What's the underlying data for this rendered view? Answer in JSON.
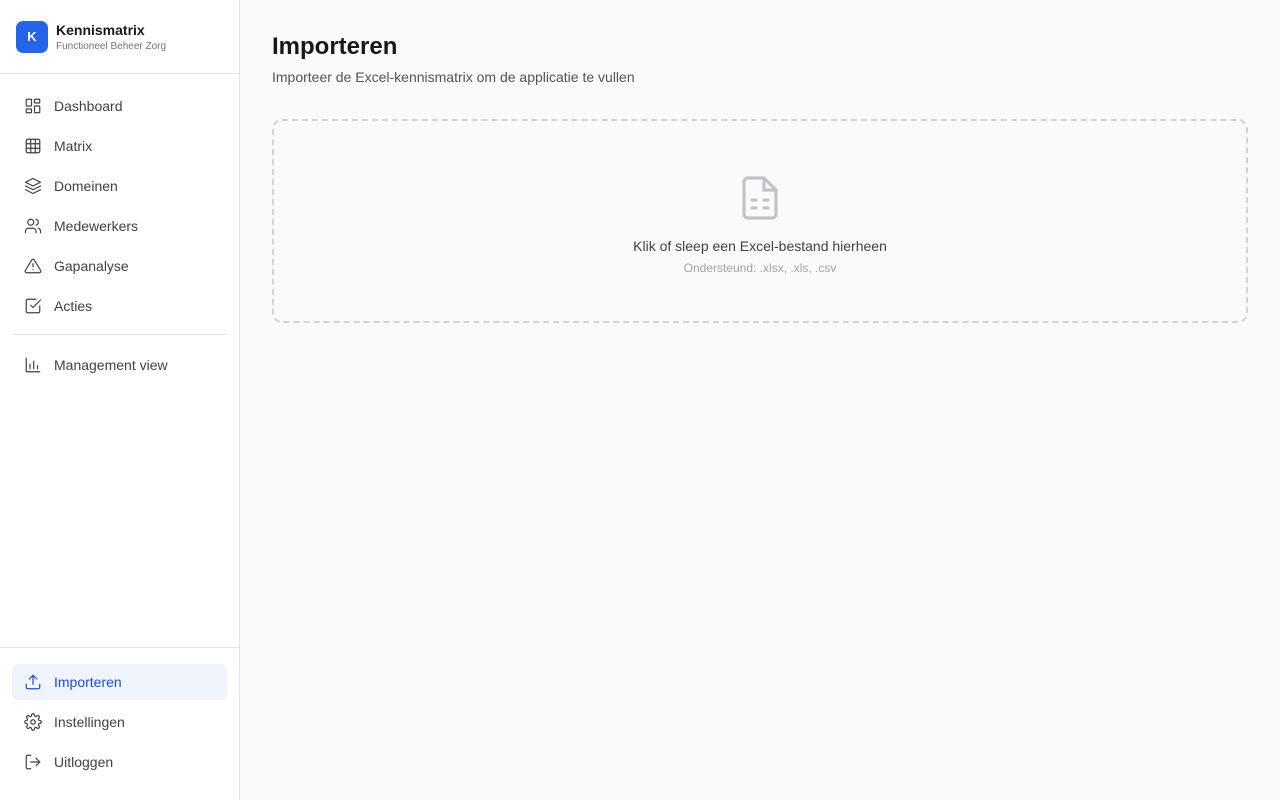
{
  "brand": {
    "logo_letter": "K",
    "name": "Kennismatrix",
    "subtitle": "Functioneel Beheer Zorg",
    "accent": "#2563eb"
  },
  "nav": {
    "main": [
      {
        "label": "Dashboard",
        "icon": "layout-dashboard-icon"
      },
      {
        "label": "Matrix",
        "icon": "grid-table-icon"
      },
      {
        "label": "Domeinen",
        "icon": "layers-icon"
      },
      {
        "label": "Medewerkers",
        "icon": "users-icon"
      },
      {
        "label": "Gapanalyse",
        "icon": "alert-triangle-icon"
      },
      {
        "label": "Acties",
        "icon": "check-square-icon"
      }
    ],
    "secondary": [
      {
        "label": "Management view",
        "icon": "bar-chart-icon"
      }
    ],
    "bottom": [
      {
        "label": "Importeren",
        "icon": "upload-icon",
        "active": true
      },
      {
        "label": "Instellingen",
        "icon": "gear-icon"
      },
      {
        "label": "Uitloggen",
        "icon": "logout-icon"
      }
    ]
  },
  "page": {
    "title": "Importeren",
    "subtitle": "Importeer de Excel-kennismatrix om de applicatie te vullen"
  },
  "dropzone": {
    "icon": "file-spreadsheet-icon",
    "title": "Klik of sleep een Excel-bestand hierheen",
    "hint": "Ondersteund: .xlsx, .xls, .csv"
  }
}
